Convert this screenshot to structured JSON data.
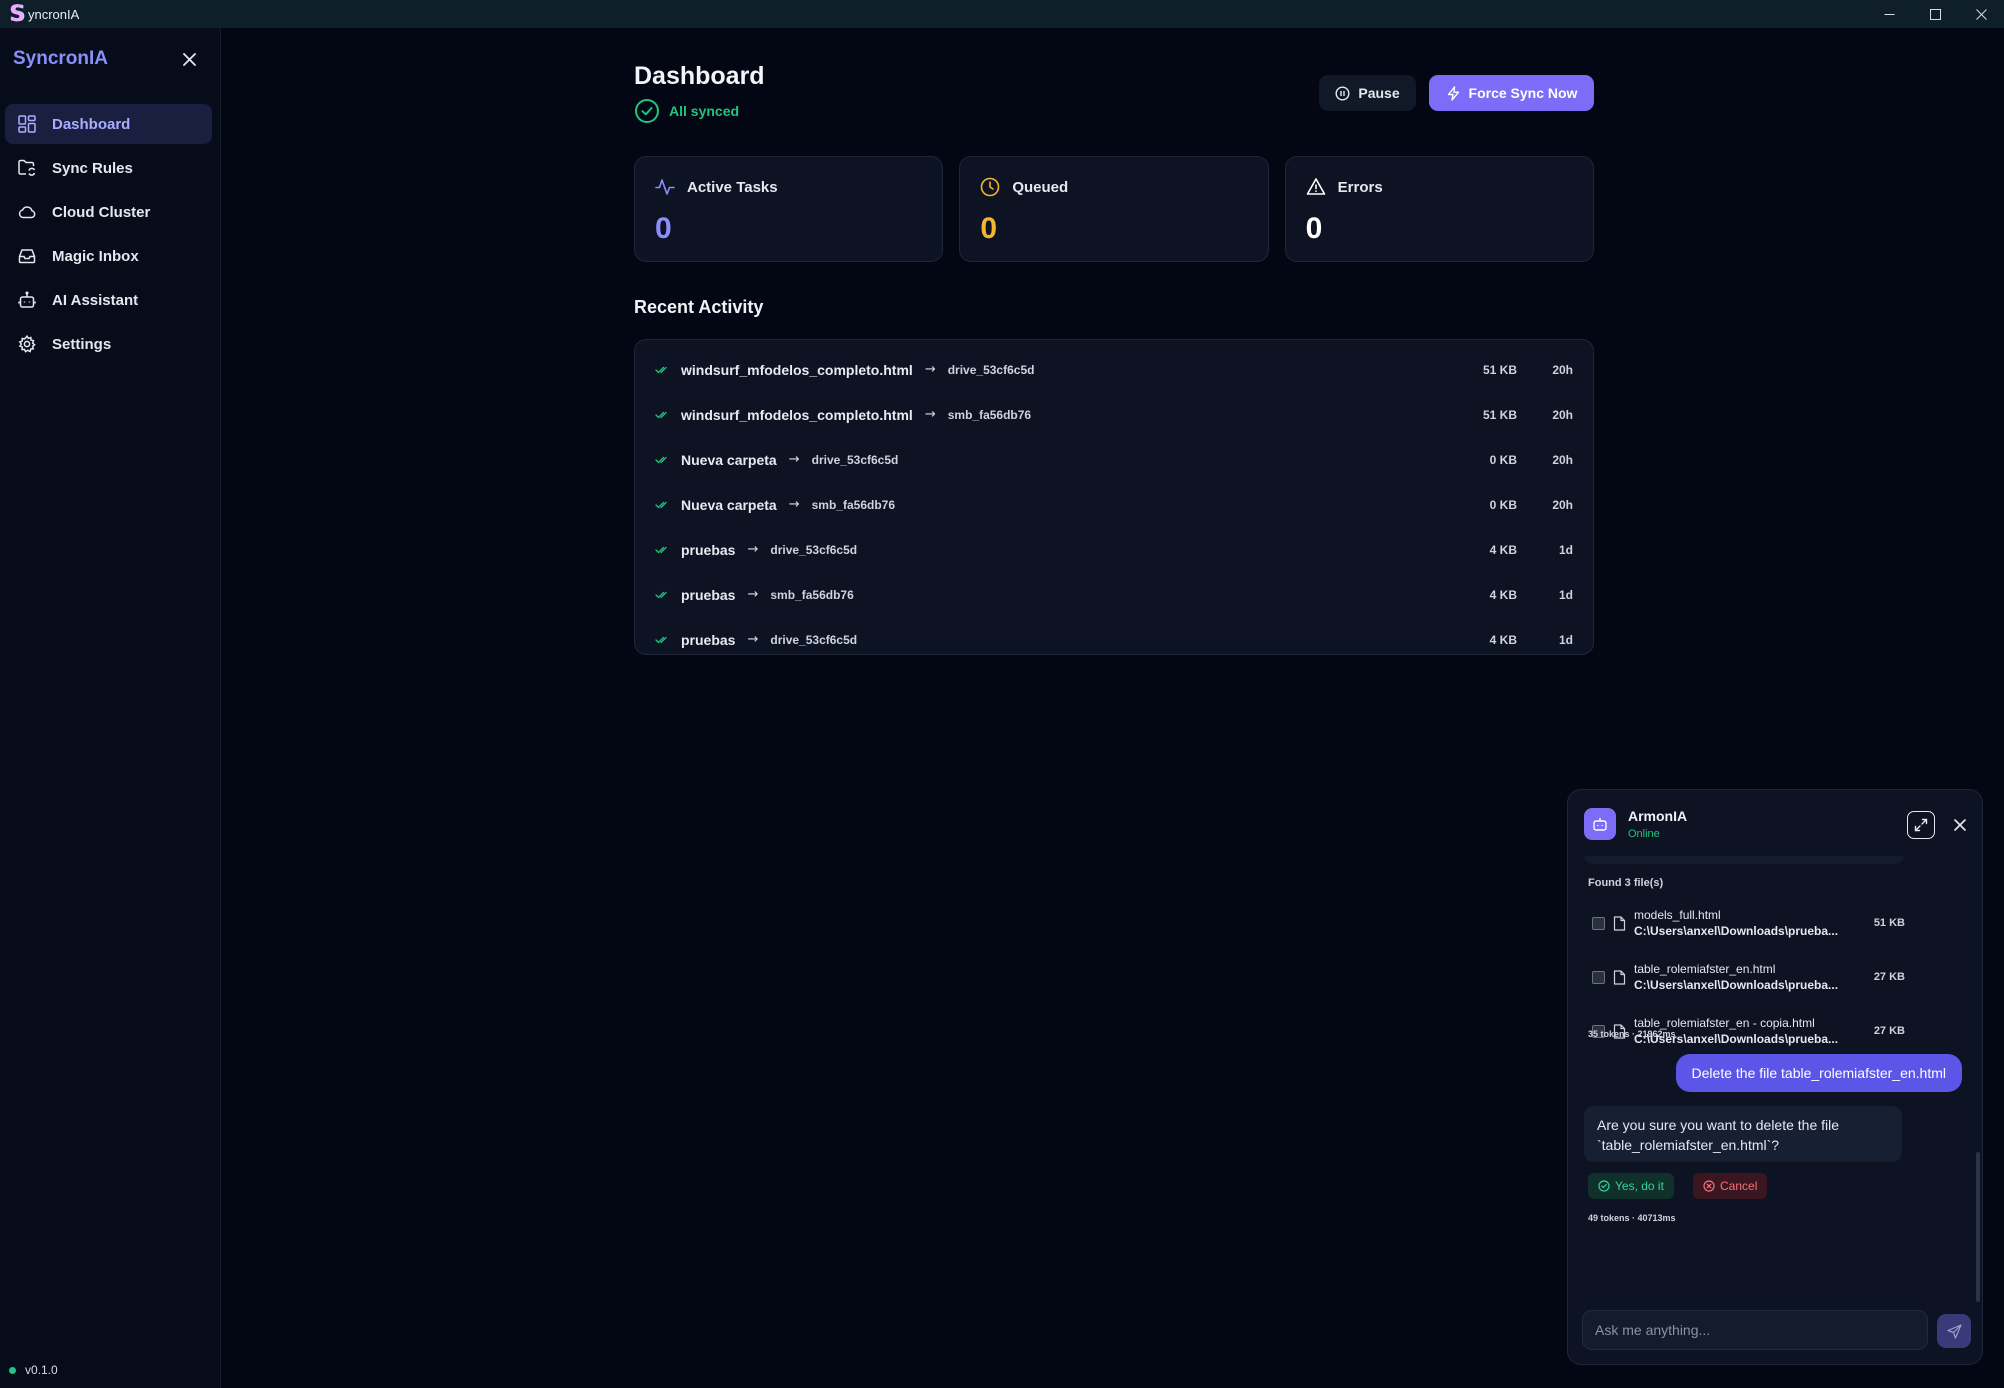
{
  "window": {
    "icon_letter": "S",
    "title": "yncronIA",
    "controls": {
      "minimize": "—",
      "maximize": "☐",
      "close": "✕"
    }
  },
  "sidebar": {
    "brand": "SyncronIA",
    "items": [
      {
        "label": "Dashboard",
        "icon": "dashboard-icon",
        "active": true
      },
      {
        "label": "Sync Rules",
        "icon": "folder-sync-icon",
        "active": false
      },
      {
        "label": "Cloud Cluster",
        "icon": "cloud-icon",
        "active": false
      },
      {
        "label": "Magic Inbox",
        "icon": "inbox-icon",
        "active": false
      },
      {
        "label": "AI Assistant",
        "icon": "bot-icon",
        "active": false
      },
      {
        "label": "Settings",
        "icon": "gear-icon",
        "active": false
      }
    ],
    "version": "v0.1.0"
  },
  "header": {
    "title": "Dashboard",
    "status": "All synced",
    "pause_label": "Pause",
    "force_sync_label": "Force Sync Now"
  },
  "stats": [
    {
      "label": "Active Tasks",
      "value": "0",
      "icon": "activity-icon",
      "color": "#8b8ffb"
    },
    {
      "label": "Queued",
      "value": "0",
      "icon": "clock-icon",
      "color": "#f5b52e"
    },
    {
      "label": "Errors",
      "value": "0",
      "icon": "warning-icon",
      "color": "#ffffff"
    }
  ],
  "recent_activity": {
    "title": "Recent Activity",
    "rows": [
      {
        "name": "windsurf_mfodelos_completo.html",
        "arrow": "→",
        "dest": "drive_53cf6c5d",
        "size": "51 KB",
        "time": "20h"
      },
      {
        "name": "windsurf_mfodelos_completo.html",
        "arrow": "→",
        "dest": "smb_fa56db76",
        "size": "51 KB",
        "time": "20h"
      },
      {
        "name": "Nueva carpeta",
        "arrow": "→",
        "dest": "drive_53cf6c5d",
        "size": "0 KB",
        "time": "20h"
      },
      {
        "name": "Nueva carpeta",
        "arrow": "→",
        "dest": "smb_fa56db76",
        "size": "0 KB",
        "time": "20h"
      },
      {
        "name": "pruebas",
        "arrow": "→",
        "dest": "drive_53cf6c5d",
        "size": "4 KB",
        "time": "1d"
      },
      {
        "name": "pruebas",
        "arrow": "→",
        "dest": "smb_fa56db76",
        "size": "4 KB",
        "time": "1d"
      },
      {
        "name": "pruebas",
        "arrow": "→",
        "dest": "drive_53cf6c5d",
        "size": "4 KB",
        "time": "1d"
      }
    ]
  },
  "chat": {
    "name": "ArmonIA",
    "status": "Online",
    "found_label": "Found 3 file(s)",
    "files": [
      {
        "name": "models_full.html",
        "path": "C:\\Users\\anxel\\Downloads\\prueba...",
        "size": "51 KB"
      },
      {
        "name": "table_rolemiafster_en.html",
        "path": "C:\\Users\\anxel\\Downloads\\prueba...",
        "size": "27 KB"
      },
      {
        "name": "table_rolemiafster_en - copia.html",
        "path": "C:\\Users\\anxel\\Downloads\\prueba...",
        "size": "27 KB"
      }
    ],
    "meta1": "35 tokens · 21962ms",
    "user_message": "Delete the file table_rolemiafster_en.html",
    "bot_message": "Are you sure you want to delete the file `table_rolemiafster_en.html`?",
    "yes_label": "Yes, do it",
    "cancel_label": "Cancel",
    "meta2": "49 tokens · 40713ms",
    "input_placeholder": "Ask me anything..."
  },
  "colors": {
    "accent": "#7c6cf7",
    "success": "#22c47e",
    "warning": "#f5b52e",
    "danger": "#f8717a"
  }
}
